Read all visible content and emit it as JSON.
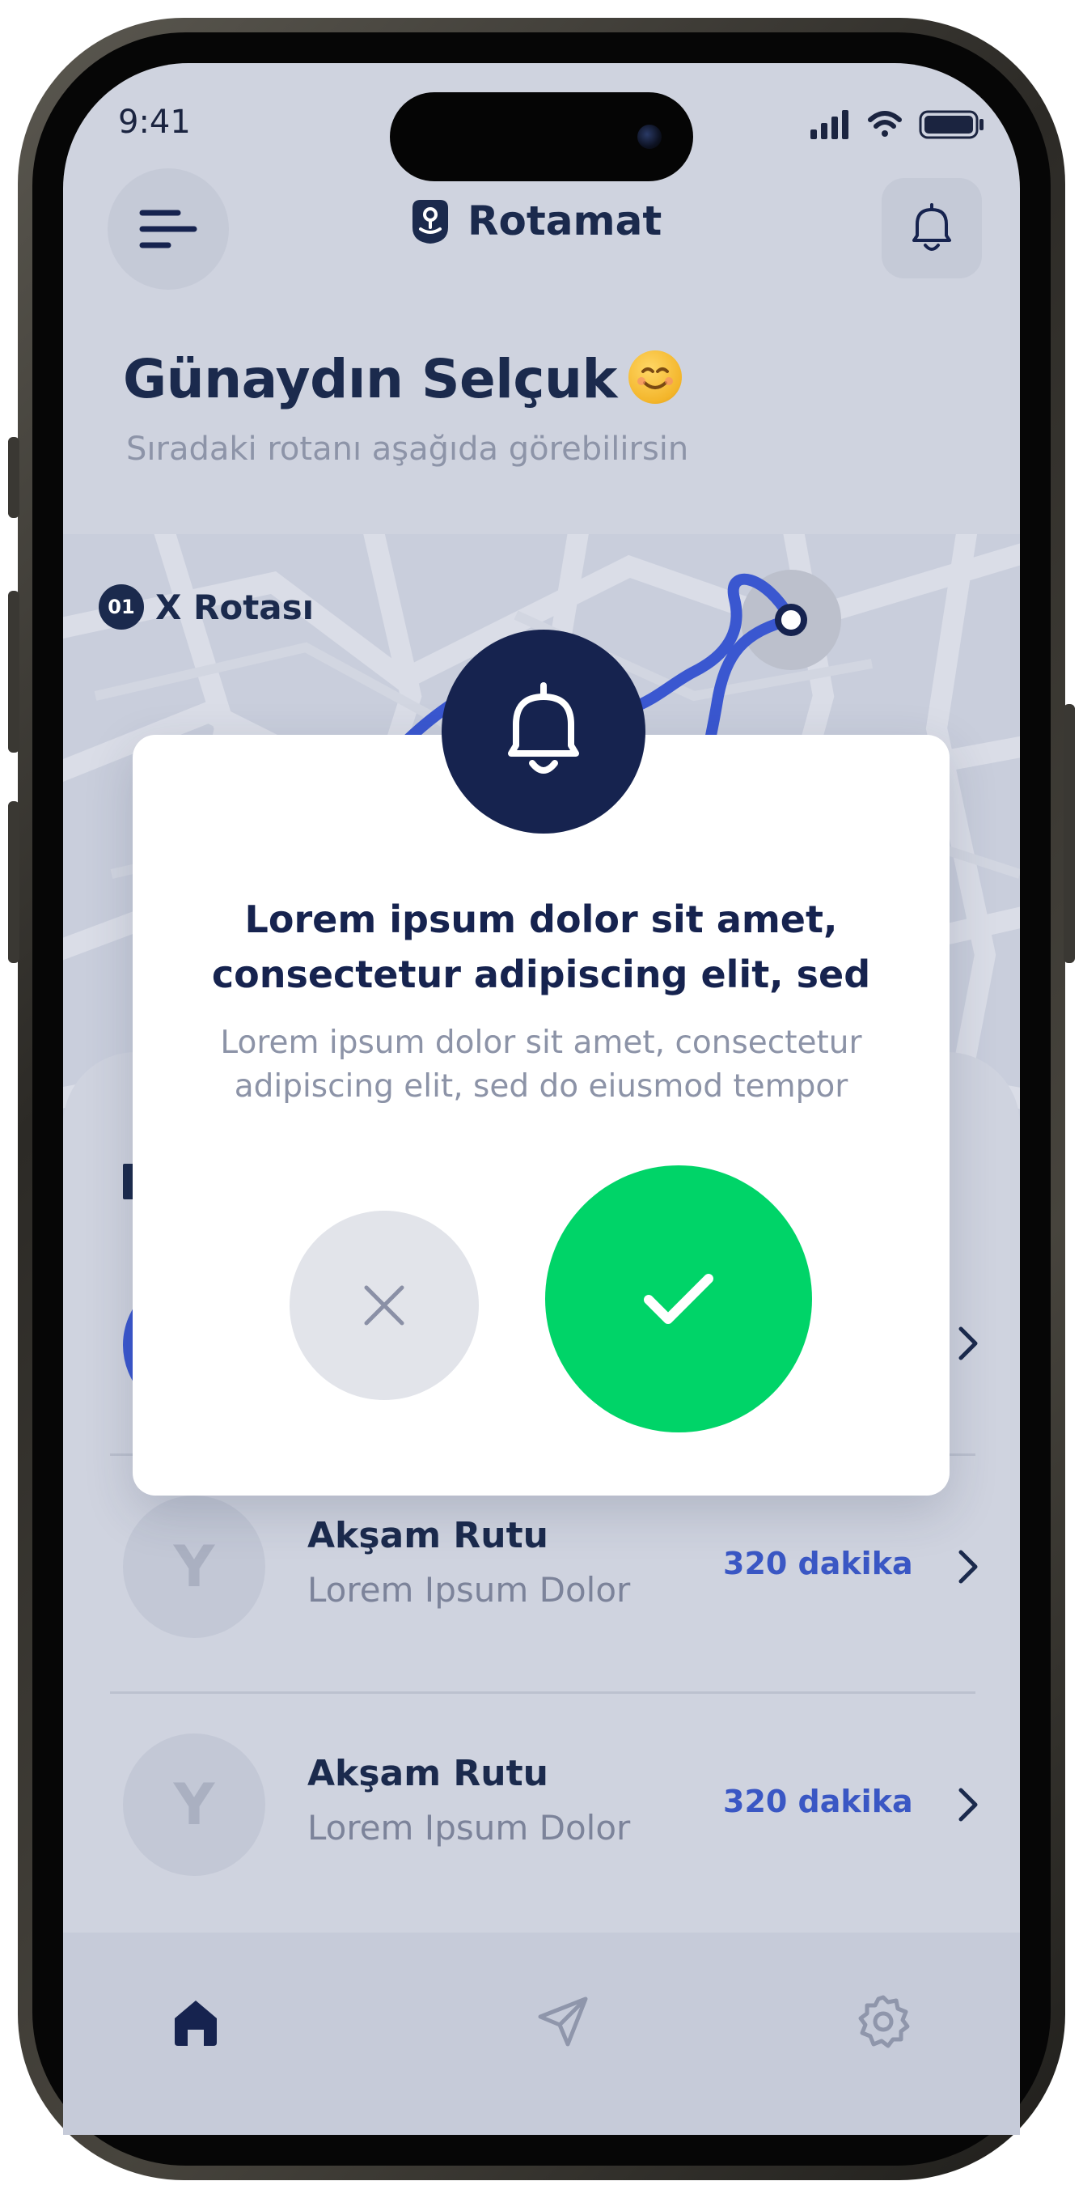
{
  "status_bar": {
    "time": "9:41",
    "icons": [
      "signal-icon",
      "wifi-icon",
      "battery-icon"
    ]
  },
  "header": {
    "brand_name": "Rotamat",
    "menu_icon": "menu-icon",
    "notification_icon": "bell-icon"
  },
  "greeting": {
    "title": "Günaydın Selçuk",
    "emoji": "smiling-face-emoji",
    "subtitle": "Sıradaki rotanı aşağıda görebilirsin"
  },
  "map": {
    "route_number": "01",
    "route_name": "X Rotası"
  },
  "list": {
    "items": [
      {
        "avatar": "Y",
        "title": "Akşam Rutu",
        "subtitle": "Lorem Ipsum Dolor",
        "duration": "320 dakika"
      },
      {
        "avatar": "Y",
        "title": "Akşam Rutu",
        "subtitle": "Lorem Ipsum Dolor",
        "duration": "320 dakika"
      }
    ]
  },
  "tabbar": {
    "tabs": [
      "home-icon",
      "send-icon",
      "settings-icon"
    ],
    "active": "home-icon"
  },
  "modal": {
    "icon": "bell-icon",
    "title": "Lorem ipsum dolor sit amet, consectetur adipiscing elit, sed",
    "text": "Lorem ipsum dolor sit amet, consectetur adipiscing elit, sed do eiusmod tempor",
    "cancel_icon": "close-icon",
    "confirm_icon": "check-icon"
  },
  "colors": {
    "brand_navy": "#16234f",
    "confirm_green": "#00d468",
    "accent_blue": "#3a57c4",
    "screen_overlay": "#cfd3df"
  }
}
